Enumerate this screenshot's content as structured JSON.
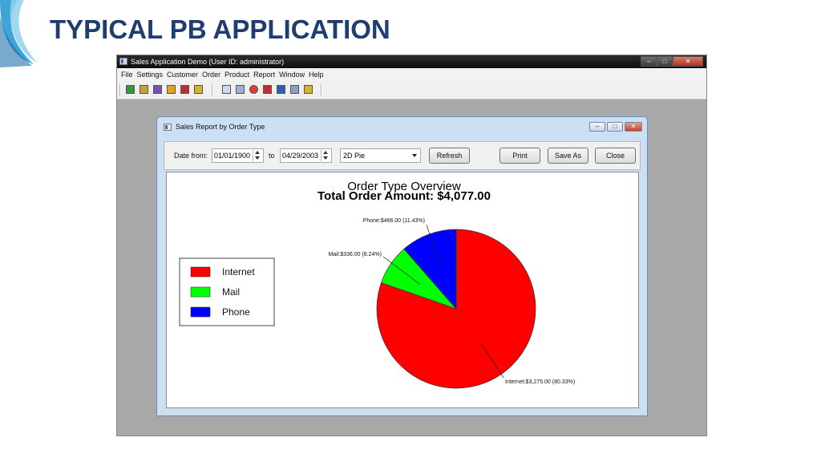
{
  "slide": {
    "title": "TYPICAL PB APPLICATION"
  },
  "app": {
    "title": "Sales Application Demo (User ID: administrator)",
    "menu": [
      "File",
      "Settings",
      "Customer",
      "Order",
      "Product",
      "Report",
      "Window",
      "Help"
    ]
  },
  "report_window": {
    "title": "Sales Report by Order Type",
    "date_from_label": "Date from:",
    "date_from": "01/01/1900",
    "to_label": "to",
    "date_to": "04/29/2003",
    "chart_style": "2D Pie",
    "refresh_label": "Refresh",
    "print_label": "Print",
    "save_as_label": "Save As",
    "close_label": "Close"
  },
  "chart_data": {
    "type": "pie",
    "title": "Order Type Overview",
    "subtitle": "Total Order Amount:  $4,077.00",
    "categories": [
      "Internet",
      "Mail",
      "Phone"
    ],
    "values": [
      3275.0,
      336.0,
      466.0
    ],
    "percents": [
      80.33,
      8.24,
      11.43
    ],
    "colors": [
      "#ff0000",
      "#00ff00",
      "#0000ff"
    ],
    "slice_labels": [
      "Internet:$3,275.00 (80.33%)",
      "Mail:$336.00 (8.24%)",
      "Phone:$466.00 (11.43%)"
    ],
    "legend_position": "left"
  }
}
